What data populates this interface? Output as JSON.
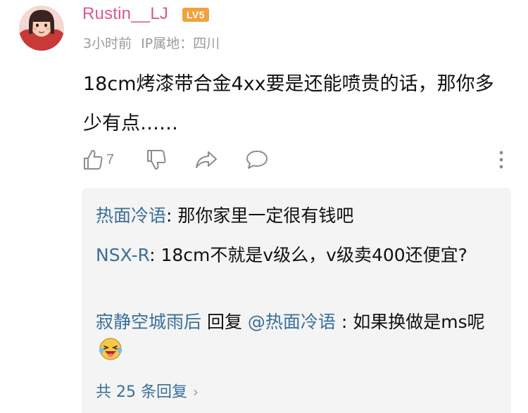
{
  "comment": {
    "username": "Rustin__LJ",
    "level_badge": "LV5",
    "time": "3小时前",
    "ip_location": "IP属地：四川",
    "text": "18cm烤漆带合金4xx要是还能喷贵的话，那你多少有点……",
    "likes": "7",
    "colors": {
      "username": "#e0568f",
      "badge": "#f2a23a",
      "reply_name": "#3a6f9b"
    }
  },
  "actions": {
    "icons": [
      "thumbs-up-icon",
      "thumbs-down-icon",
      "share-icon",
      "comment-icon",
      "more-icon"
    ]
  },
  "replies": [
    {
      "user": "热面冷语",
      "separator": ": ",
      "text": "那你家里一定很有钱吧"
    },
    {
      "user": "NSX-R",
      "separator": ": ",
      "text": "18cm不就是v级么，v级卖400还便宜?"
    },
    {
      "user": "寂静空城雨后",
      "reply_word": " 回复 ",
      "mention": "@热面冷语",
      "separator": " : ",
      "text": "如果换做是ms呢",
      "emoji": "laughing-face-emoji"
    }
  ],
  "view_more": "共 25 条回复"
}
